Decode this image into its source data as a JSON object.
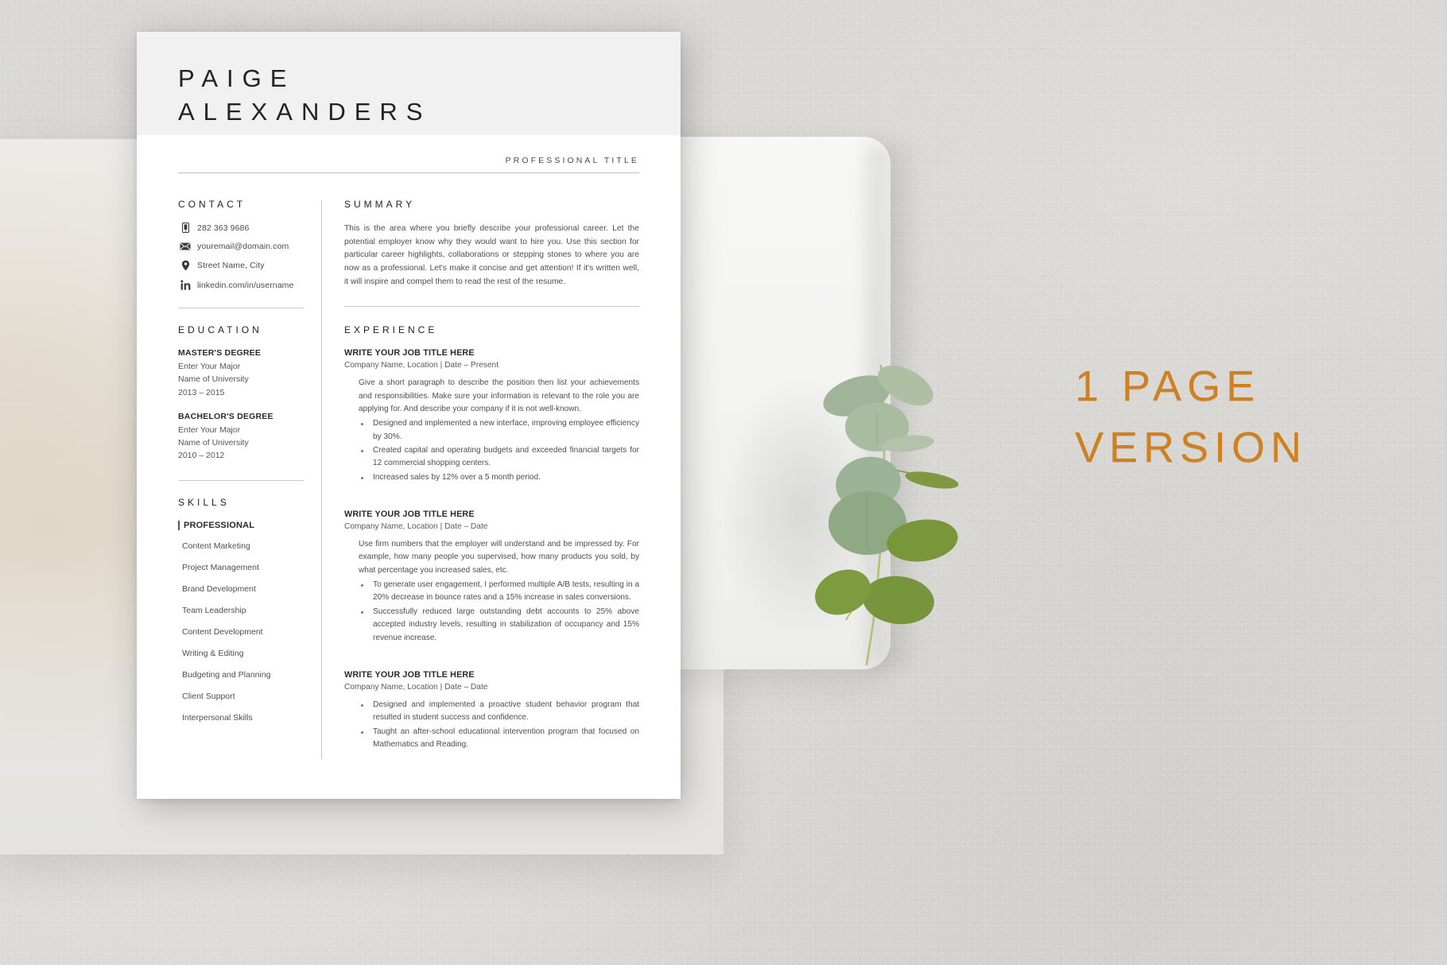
{
  "resume": {
    "name_first": "PAIGE",
    "name_last": "ALEXANDERS",
    "professional_title": "PROFESSIONAL TITLE",
    "contact": {
      "heading": "CONTACT",
      "items": [
        {
          "icon": "phone-icon",
          "text": "282 363 9686"
        },
        {
          "icon": "envelope-icon",
          "text": "youremail@domain.com"
        },
        {
          "icon": "location-pin-icon",
          "text": "Street Name, City"
        },
        {
          "icon": "linkedin-icon",
          "text": "linkedin.com/in/username"
        }
      ]
    },
    "education": {
      "heading": "EDUCATION",
      "entries": [
        {
          "degree": "MASTER'S DEGREE",
          "major": "Enter Your Major",
          "school": "Name of University",
          "years": "2013 – 2015"
        },
        {
          "degree": "BACHELOR'S DEGREE",
          "major": "Enter Your Major",
          "school": "Name of University",
          "years": "2010 – 2012"
        }
      ]
    },
    "skills": {
      "heading": "SKILLS",
      "group_label": "PROFESSIONAL",
      "items": [
        "Content Marketing",
        "Project Management",
        "Brand Development",
        "Team Leadership",
        "Content Development",
        "Writing & Editing",
        "Budgeting and Planning",
        "Client Support",
        "Interpersonal Skills"
      ]
    },
    "summary": {
      "heading": "SUMMARY",
      "text": "This is the area where you briefly describe your professional career. Let the potential employer know why they would want to hire you. Use this section for particular career highlights, collaborations or stepping stones to where you are now as a professional. Let's make it concise and get attention! If it's written well, it will inspire and compel them to read the rest of the resume."
    },
    "experience": {
      "heading": "EXPERIENCE",
      "jobs": [
        {
          "title": "WRITE YOUR JOB TITLE HERE",
          "meta": "Company Name, Location | Date – Present",
          "description": "Give a short paragraph to describe the position then list your achievements and responsibilities. Make sure your information is relevant to the role you are applying for. And describe your company if it is not well-known.",
          "bullets": [
            "Designed and implemented a new interface, improving employee efficiency by 30%.",
            "Created capital and operating budgets and exceeded financial targets for 12 commercial shopping centers.",
            "Increased sales by 12% over a 5 month period."
          ]
        },
        {
          "title": "WRITE YOUR JOB TITLE HERE",
          "meta": "Company Name, Location | Date – Date",
          "description": "Use firm numbers that the employer will understand and be impressed by. For example, how many people you supervised, how many products you sold, by what percentage you increased sales, etc.",
          "bullets": [
            "To generate user engagement, I performed multiple A/B tests, resulting in a 20% decrease in bounce rates and a 15% increase in sales conversions.",
            "Successfully reduced large outstanding debt accounts to 25% above accepted industry levels, resulting in stabilization of occupancy and 15% revenue increase."
          ]
        },
        {
          "title": "WRITE YOUR JOB TITLE HERE",
          "meta": "Company Name, Location | Date – Date",
          "description": "",
          "bullets": [
            "Designed and implemented a proactive student behavior program that resulted in student success and confidence.",
            "Taught an after-school educational intervention program that focused on Mathematics and Reading."
          ]
        }
      ]
    }
  },
  "promo": {
    "line1": "1 PAGE",
    "line2": "VERSION",
    "color": "#cf8020"
  },
  "decor": {
    "plant": "eucalyptus-sprig",
    "background": "grey-textured-surface"
  }
}
